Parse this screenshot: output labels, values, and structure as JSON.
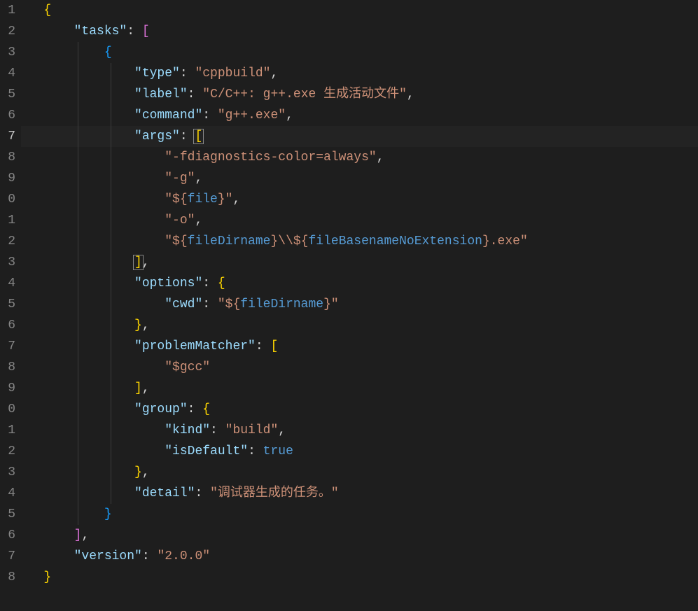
{
  "lineNumbers": [
    "1",
    "2",
    "3",
    "4",
    "5",
    "6",
    "7",
    "8",
    "9",
    "0",
    "1",
    "2",
    "3",
    "4",
    "5",
    "6",
    "7",
    "8",
    "9",
    "0",
    "1",
    "2",
    "3",
    "4",
    "5",
    "6",
    "7",
    "8"
  ],
  "activeLine": 7,
  "code": {
    "tasks_key": "\"tasks\"",
    "task": {
      "type_key": "\"type\"",
      "type_val": "\"cppbuild\"",
      "label_key": "\"label\"",
      "label_val": "\"C/C++: g++.exe 生成活动文件\"",
      "command_key": "\"command\"",
      "command_val": "\"g++.exe\"",
      "args_key": "\"args\"",
      "args": {
        "a0": "\"-fdiagnostics-color=always\"",
        "a1": "\"-g\"",
        "a2_pre": "\"${",
        "a2_mid": "file",
        "a2_post": "}\"",
        "a3": "\"-o\"",
        "a4_pre": "\"${",
        "a4_m1": "fileDirname",
        "a4_sep": "}\\\\${",
        "a4_m2": "fileBasenameNoExtension",
        "a4_post": "}.exe\""
      },
      "options_key": "\"options\"",
      "options": {
        "cwd_key": "\"cwd\"",
        "cwd_pre": "\"${",
        "cwd_mid": "fileDirname",
        "cwd_post": "}\""
      },
      "problemMatcher_key": "\"problemMatcher\"",
      "problemMatcher_val": "\"$gcc\"",
      "group_key": "\"group\"",
      "group": {
        "kind_key": "\"kind\"",
        "kind_val": "\"build\"",
        "isDefault_key": "\"isDefault\"",
        "isDefault_val": "true"
      },
      "detail_key": "\"detail\"",
      "detail_val": "\"调试器生成的任务。\""
    },
    "version_key": "\"version\"",
    "version_val": "\"2.0.0\""
  }
}
